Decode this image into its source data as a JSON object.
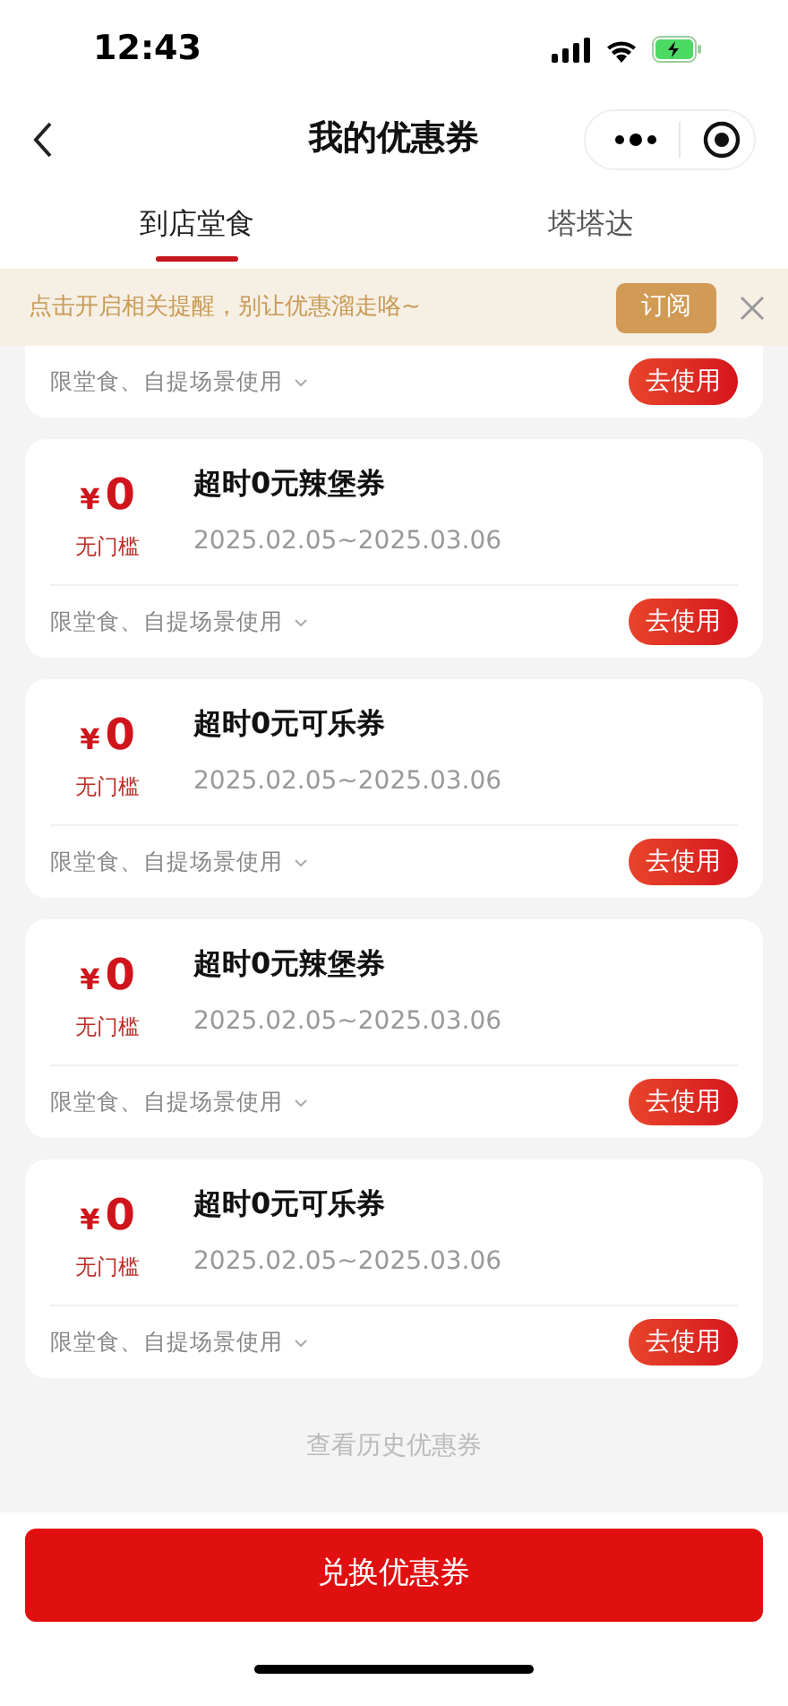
{
  "status_bar": {
    "time": "12:43"
  },
  "nav": {
    "title": "我的优惠券"
  },
  "tabs": [
    {
      "label": "到店堂食",
      "selected": true
    },
    {
      "label": "塔塔达",
      "selected": false
    }
  ],
  "banner": {
    "text": "点击开启相关提醒，别让优惠溜走咯~",
    "button": "订阅"
  },
  "coupons": [
    {
      "kind": "partial",
      "scope": "限堂食、自提场景使用",
      "button": "去使用"
    },
    {
      "kind": "full",
      "amount": "0",
      "currency": "¥",
      "threshold": "无门槛",
      "title": "超时0元辣堡券",
      "period": "2025.02.05~2025.03.06",
      "scope": "限堂食、自提场景使用",
      "button": "去使用"
    },
    {
      "kind": "full",
      "amount": "0",
      "currency": "¥",
      "threshold": "无门槛",
      "title": "超时0元可乐券",
      "period": "2025.02.05~2025.03.06",
      "scope": "限堂食、自提场景使用",
      "button": "去使用"
    },
    {
      "kind": "full",
      "amount": "0",
      "currency": "¥",
      "threshold": "无门槛",
      "title": "超时0元辣堡券",
      "period": "2025.02.05~2025.03.06",
      "scope": "限堂食、自提场景使用",
      "button": "去使用"
    },
    {
      "kind": "full",
      "amount": "0",
      "currency": "¥",
      "threshold": "无门槛",
      "title": "超时0元可乐券",
      "period": "2025.02.05~2025.03.06",
      "scope": "限堂食、自提场景使用",
      "button": "去使用"
    }
  ],
  "history_link": "查看历史优惠券",
  "redeem_button": "兑换优惠券"
}
